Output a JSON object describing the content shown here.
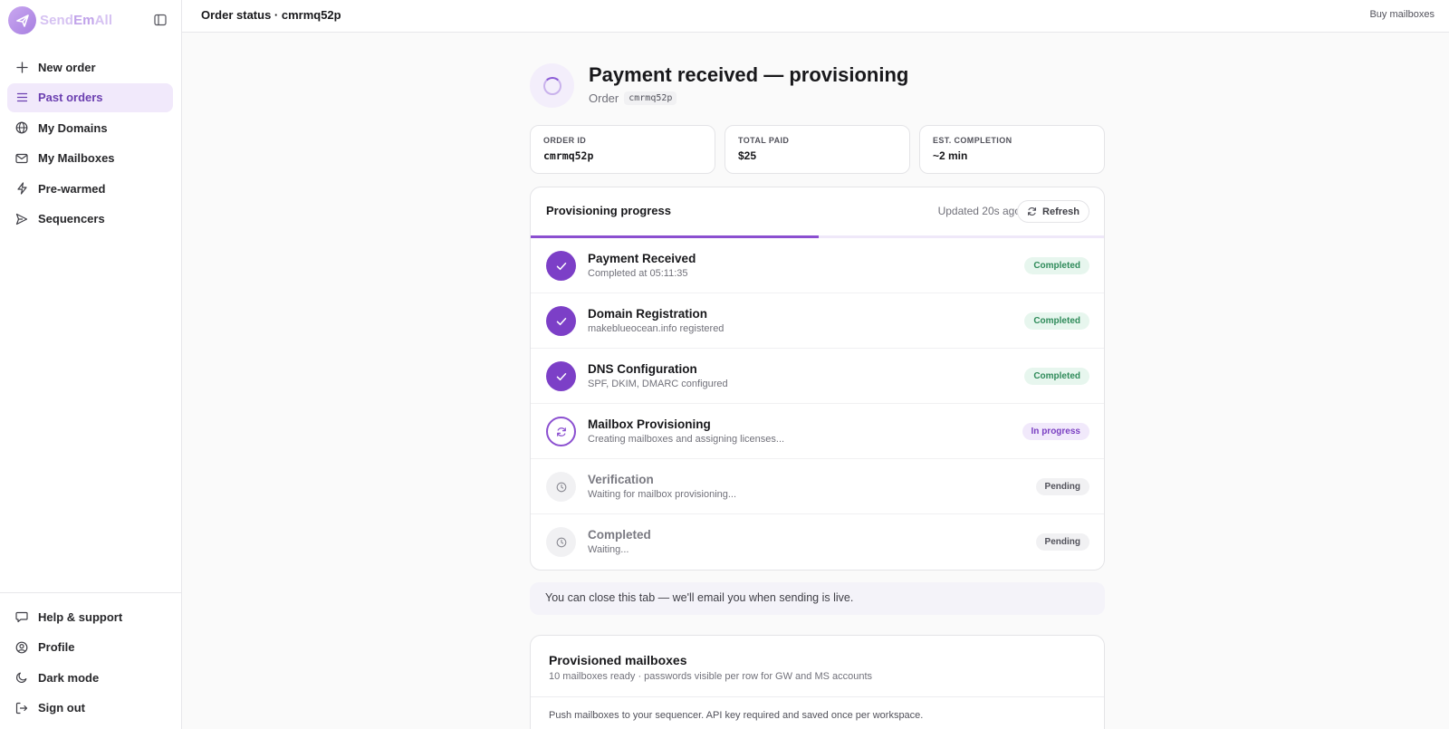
{
  "brand": {
    "name_part1": "Send",
    "name_part2": "Em",
    "name_part3": "All"
  },
  "sidebar": {
    "items": [
      {
        "label": "New order",
        "icon": "plus-icon"
      },
      {
        "label": "Past orders",
        "icon": "list-icon",
        "active": true
      },
      {
        "label": "My Domains",
        "icon": "globe-icon"
      },
      {
        "label": "My Mailboxes",
        "icon": "mail-icon"
      },
      {
        "label": "Pre-warmed",
        "icon": "bolt-icon"
      },
      {
        "label": "Sequencers",
        "icon": "send-icon"
      }
    ],
    "bottom_items": [
      {
        "label": "Help & support",
        "icon": "chat-icon"
      },
      {
        "label": "Profile",
        "icon": "user-circle-icon"
      },
      {
        "label": "Dark mode",
        "icon": "moon-icon"
      },
      {
        "label": "Sign out",
        "icon": "logout-icon"
      }
    ]
  },
  "topbar": {
    "title": "Order status · cmrmq52p",
    "link": "Buy mailboxes"
  },
  "header": {
    "title": "Payment received — provisioning",
    "order_label": "Order",
    "order_code": "cmrmq52p"
  },
  "stats": [
    {
      "label": "Order ID",
      "value": "cmrmq52p"
    },
    {
      "label": "Total paid",
      "value": "$25"
    },
    {
      "label": "Est. completion",
      "value": "~2 min"
    }
  ],
  "progress": {
    "title": "Provisioning progress",
    "updated": "Updated 20s ago",
    "refresh_label": "Refresh",
    "fraction": 0.5,
    "accent": "#8b4fd0",
    "steps": [
      {
        "name": "Payment Received",
        "desc": "Completed at 05:11:35",
        "status": "Completed",
        "state": "done"
      },
      {
        "name": "Domain Registration",
        "desc": "makeblueocean.info registered",
        "status": "Completed",
        "state": "done"
      },
      {
        "name": "DNS Configuration",
        "desc": "SPF, DKIM, DMARC configured",
        "status": "Completed",
        "state": "done"
      },
      {
        "name": "Mailbox Provisioning",
        "desc": "Creating mailboxes and assigning licenses...",
        "status": "In progress",
        "state": "active"
      },
      {
        "name": "Verification",
        "desc": "Waiting for mailbox provisioning...",
        "status": "Pending",
        "state": "pending"
      },
      {
        "name": "Completed",
        "desc": "Waiting...",
        "status": "Pending",
        "state": "pending"
      }
    ]
  },
  "notice": "You can close this tab — we'll email you when sending is live.",
  "mailboxes": {
    "title": "Provisioned mailboxes",
    "subtitle": "10 mailboxes ready · passwords visible per row for GW and MS accounts",
    "push_text": "Push mailboxes to your sequencer. API key required and saved once per workspace."
  }
}
